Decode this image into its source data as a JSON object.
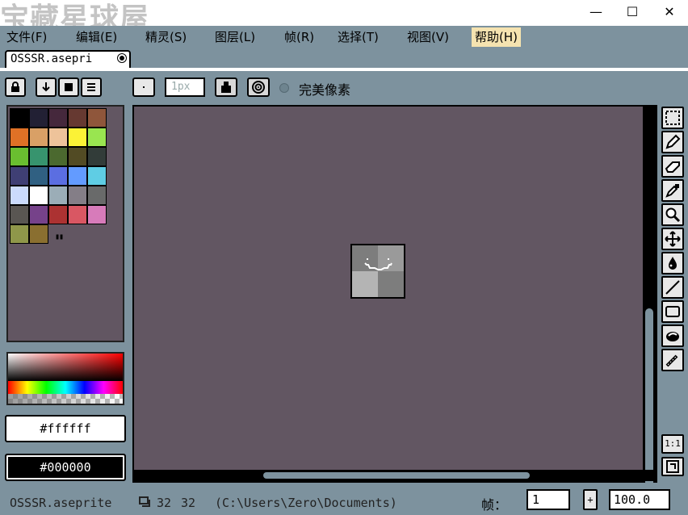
{
  "window": {
    "watermark": "宝藏星球屋",
    "minimize": "—",
    "maximize": "☐",
    "close": "✕"
  },
  "menu": {
    "items": [
      "文件(F)",
      "编辑(E)",
      "精灵(S)",
      "图层(L)",
      "帧(R)",
      "选择(T)",
      "视图(V)",
      "帮助(H)"
    ],
    "active_index": 7
  },
  "tab": {
    "label": "OSSSR.asepri"
  },
  "toolbar": {
    "brush_size": "1px",
    "pixel_perfect_label": "完美像素",
    "pixel_perfect_checked": false
  },
  "palette": {
    "colors": [
      "#000000",
      "#222034",
      "#45283c",
      "#663931",
      "#8f563b",
      "#df7126",
      "#d9a066",
      "#eec39a",
      "#fbf236",
      "#99e550",
      "#6abe30",
      "#37946e",
      "#4b692f",
      "#524b24",
      "#323c39",
      "#3f3f74",
      "#306082",
      "#5b6ee1",
      "#639bff",
      "#5fcde4",
      "#cbdbfc",
      "#ffffff",
      "#9badb7",
      "#847e87",
      "#696a6a",
      "#595652",
      "#76428a",
      "#ac3232",
      "#d95763",
      "#d77bba",
      "#8f974a",
      "#8a6f30"
    ]
  },
  "colors": {
    "foreground_hex": "#ffffff",
    "background_hex": "#000000"
  },
  "sprite": {
    "quadrants": [
      "#7d7d7d",
      "#9a9a9a",
      "#b4b4b4",
      "#7d7d7d"
    ]
  },
  "tools": [
    "marquee-icon",
    "pencil-icon",
    "eraser-icon",
    "eyedropper-icon",
    "zoom-icon",
    "move-icon",
    "paint-bucket-icon",
    "line-icon",
    "rectangle-icon",
    "ellipse-icon",
    "spray-icon"
  ],
  "zoom_buttons": {
    "actual_size": "1:1"
  },
  "status": {
    "filename": "OSSSR.aseprite",
    "width": "32",
    "height": "32",
    "path": "(C:\\Users\\Zero\\Documents)",
    "frame_label": "帧：",
    "frame_value": "1",
    "frame_plus": "+",
    "zoom_value": "100.0"
  }
}
